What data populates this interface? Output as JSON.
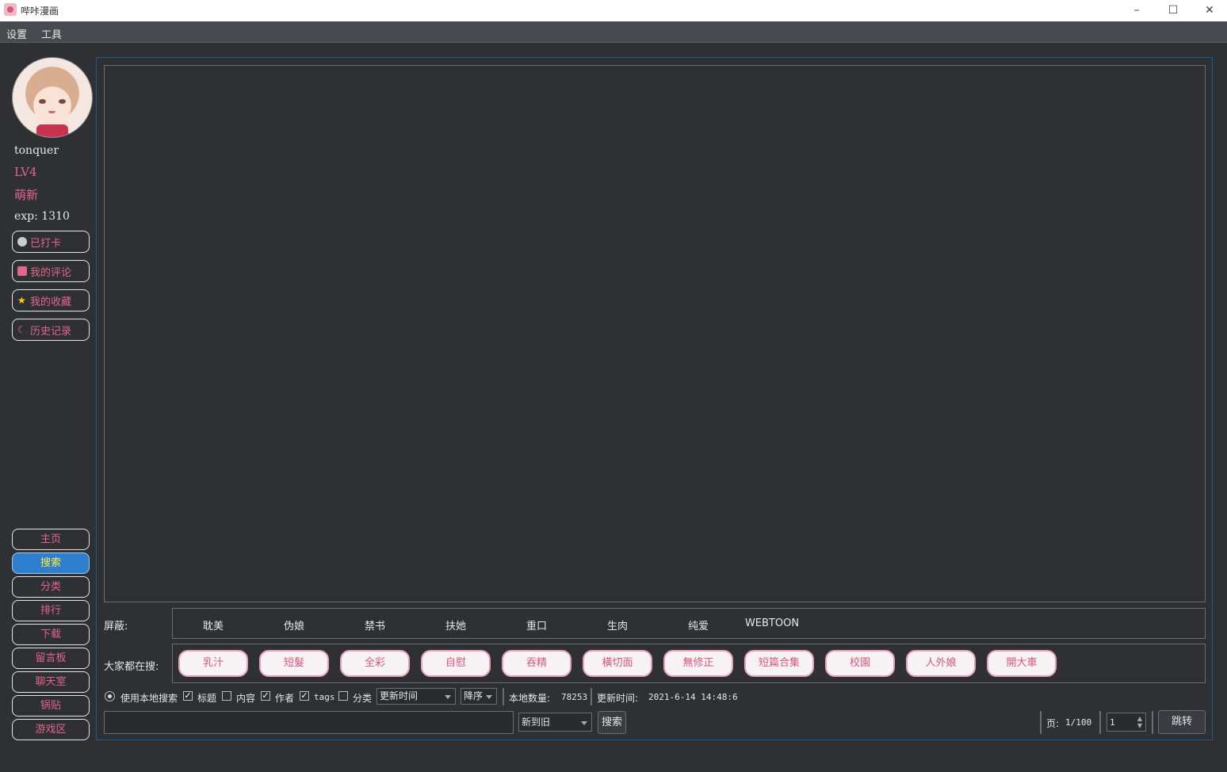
{
  "window": {
    "title": "哔咔漫画"
  },
  "menu": {
    "settings": "设置",
    "tools": "工具"
  },
  "user": {
    "name": "tonquer",
    "level": "LV4",
    "title": "萌新",
    "exp": "exp: 1310"
  },
  "actions": {
    "checkin": "已打卡",
    "comments": "我的评论",
    "favorites": "我的收藏",
    "history": "历史记录"
  },
  "nav": {
    "home": "主页",
    "search": "搜索",
    "category": "分类",
    "rank": "排行",
    "download": "下载",
    "board": "留言板",
    "chat": "聊天室",
    "posts": "锅贴",
    "games": "游戏区"
  },
  "block": {
    "label": "屏蔽:",
    "tags": [
      "耽美",
      "伪娘",
      "禁书",
      "扶她",
      "重口",
      "生肉",
      "纯爱",
      "WEBTOON"
    ]
  },
  "hot": {
    "label": "大家都在搜:",
    "tags": [
      "乳汁",
      "短髮",
      "全彩",
      "自慰",
      "吞精",
      "橫切面",
      "無修正",
      "短篇合集",
      "校園",
      "人外娘",
      "開大車"
    ]
  },
  "options": {
    "local_search": "使用本地搜索",
    "title": "标题",
    "title_checked": true,
    "content": "内容",
    "content_checked": false,
    "author": "作者",
    "author_checked": true,
    "tags": "tags",
    "tags_checked": true,
    "category": "分类",
    "category_checked": false,
    "sort_field": "更新时间",
    "sort_order": "降序",
    "local_count_label": "本地数量:",
    "local_count": "78253",
    "update_time_label": "更新时间:",
    "update_time": "2021-6-14 14:48:6"
  },
  "search": {
    "order": "新到旧",
    "button": "搜索",
    "query": ""
  },
  "pager": {
    "page_label": "页:",
    "page_info": "1/100",
    "page_input": "1",
    "jump": "跳转"
  }
}
